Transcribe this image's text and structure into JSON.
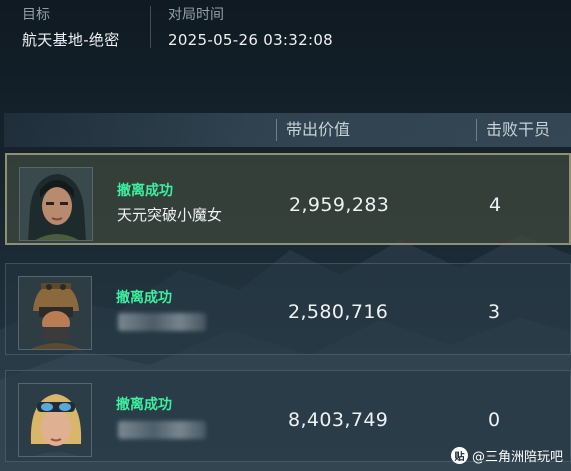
{
  "header": {
    "target_label": "目标",
    "target_value": "航天基地-绝密",
    "time_label": "对局时间",
    "time_value": "2025-05-26 03:32:08"
  },
  "columns": {
    "value": "带出价值",
    "kills": "击败干员"
  },
  "rows": [
    {
      "status": "撤离成功",
      "name": "天元突破小魔女",
      "name_hidden": false,
      "value": "2,959,283",
      "kills": "4",
      "selected": true,
      "avatar": "operator-hooded-woman"
    },
    {
      "status": "撤离成功",
      "name": "",
      "name_hidden": true,
      "value": "2,580,716",
      "kills": "3",
      "selected": false,
      "avatar": "operator-helmet-mask"
    },
    {
      "status": "撤离成功",
      "name": "",
      "name_hidden": true,
      "value": "8,403,749",
      "kills": "0",
      "selected": false,
      "avatar": "operator-blonde-goggles"
    }
  ],
  "watermark": {
    "platform": "贴",
    "text": "@三角洲陪玩吧"
  },
  "colors": {
    "status_green": "#3cf0a0",
    "selected_border": "#8f8f74"
  }
}
